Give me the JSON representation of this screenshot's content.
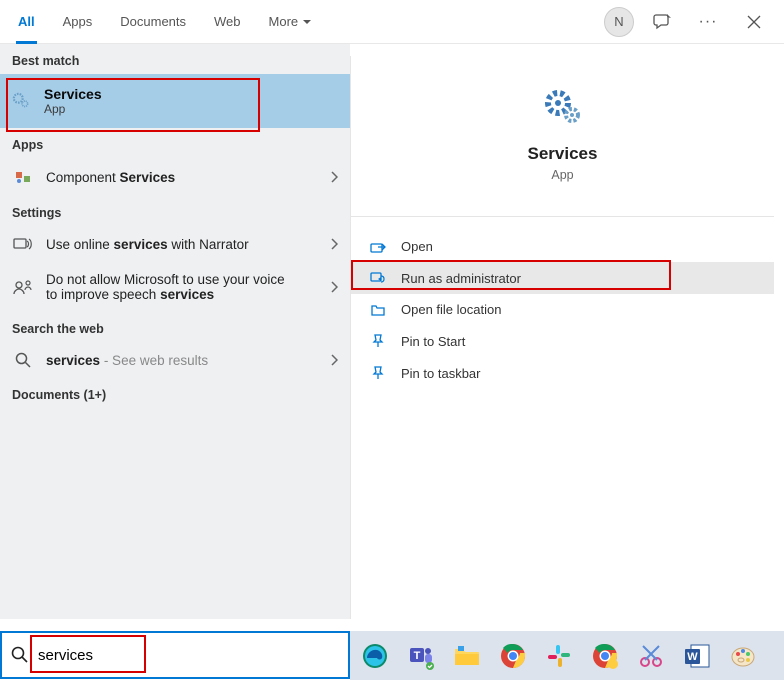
{
  "tabs": {
    "all": "All",
    "apps": "Apps",
    "documents": "Documents",
    "web": "Web",
    "more": "More"
  },
  "avatar_initial": "N",
  "left": {
    "best_match_label": "Best match",
    "best_match": {
      "title": "Services",
      "subtitle": "App"
    },
    "apps_label": "Apps",
    "component_services_pre": "Component ",
    "component_services_b": "Services",
    "settings_label": "Settings",
    "narrator_pre": "Use online ",
    "narrator_b": "services",
    "narrator_post": " with Narrator",
    "speech_pre": "Do not allow Microsoft to use your voice to improve speech ",
    "speech_b": "services",
    "web_label": "Search the web",
    "web_term": "services",
    "web_suffix": " - See web results",
    "docs_label": "Documents (1+)"
  },
  "right": {
    "title": "Services",
    "subtitle": "App",
    "actions": {
      "open": "Open",
      "run_admin": "Run as administrator",
      "open_loc": "Open file location",
      "pin_start": "Pin to Start",
      "pin_taskbar": "Pin to taskbar"
    }
  },
  "search_value": "services"
}
